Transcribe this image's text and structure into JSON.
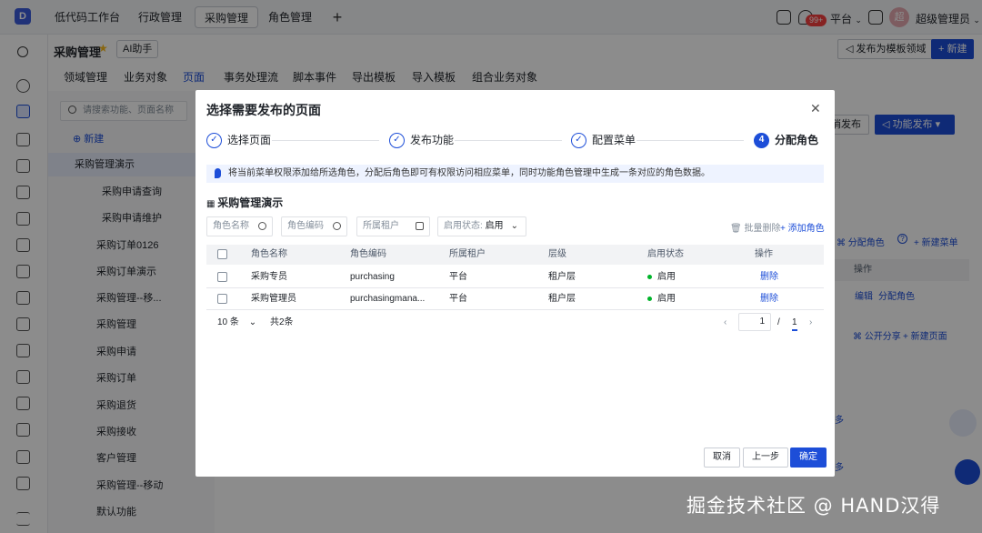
{
  "topbar": {
    "logo": "D",
    "tabs": [
      "低代码工作台",
      "行政管理",
      "采购管理",
      "角色管理"
    ],
    "active_tab": "采购管理",
    "notification_count": "99+",
    "platform": "平台",
    "avatar_initial": "超",
    "user_name": "超级管理员"
  },
  "header": {
    "title": "采购管理",
    "ai_button": "AI助手",
    "publish_template": "发布为模板领域",
    "new_button": "新建"
  },
  "page_tabs": [
    "领域管理",
    "业务对象",
    "页面",
    "事务处理流",
    "脚本事件",
    "导出模板",
    "导入模板",
    "组合业务对象"
  ],
  "active_page_tab": "页面",
  "tree": {
    "search_placeholder": "请搜索功能、页面名称",
    "new_label": "新建",
    "items": [
      "采购管理演示",
      "采购申请查询",
      "采购申请维护",
      "采购订单0126",
      "采购订单演示",
      "采购管理--移...",
      "采购管理",
      "采购申请",
      "采购订单",
      "采购退货",
      "采购接收",
      "客户管理",
      "采购管理--移动",
      "默认功能"
    ]
  },
  "background_right": {
    "cancel_publish": "消发布",
    "function_publish": "功能发布",
    "assign_role": "分配角色",
    "new_menu": "新建菜单",
    "op_header": "操作",
    "edit": "编辑",
    "assign_role2": "分配角色",
    "public_share": "公开分享",
    "new_page": "新建页面",
    "more1": "多",
    "more2": "多"
  },
  "modal": {
    "title": "选择需要发布的页面",
    "steps": [
      {
        "label": "选择页面",
        "state": "done"
      },
      {
        "label": "发布功能",
        "state": "done"
      },
      {
        "label": "配置菜单",
        "state": "done"
      },
      {
        "label": "分配角色",
        "state": "current",
        "num": "4"
      }
    ],
    "notice": "将当前菜单权限添加给所选角色，分配后角色即可有权限访问相应菜单，同时功能角色管理中生成一条对应的角色数据。",
    "section_title": "采购管理演示",
    "filters": {
      "role_name_placeholder": "角色名称",
      "role_code_placeholder": "角色编码",
      "tenant_placeholder": "所属租户",
      "status_label": "启用状态:",
      "status_value": "启用"
    },
    "bulk_delete": "批量删除",
    "add_role": "添加角色",
    "columns": [
      "角色名称",
      "角色编码",
      "所属租户",
      "层级",
      "启用状态",
      "操作"
    ],
    "rows": [
      {
        "name": "采购专员",
        "code": "purchasing",
        "tenant": "平台",
        "level": "租户层",
        "status": "启用",
        "action": "删除"
      },
      {
        "name": "采购管理员",
        "code": "purchasingmana...",
        "tenant": "平台",
        "level": "租户层",
        "status": "启用",
        "action": "删除"
      }
    ],
    "page_size": "10 条",
    "total": "共2条",
    "current_page": "1",
    "page_sep": "/",
    "total_pages": "1",
    "buttons": {
      "cancel": "取消",
      "prev": "上一步",
      "ok": "确定"
    }
  },
  "watermark": "掘金技术社区 @ HAND汉得",
  "colors": {
    "accent": "#1d4ed8",
    "success": "#00b42a",
    "badge": "#f53f3f"
  }
}
